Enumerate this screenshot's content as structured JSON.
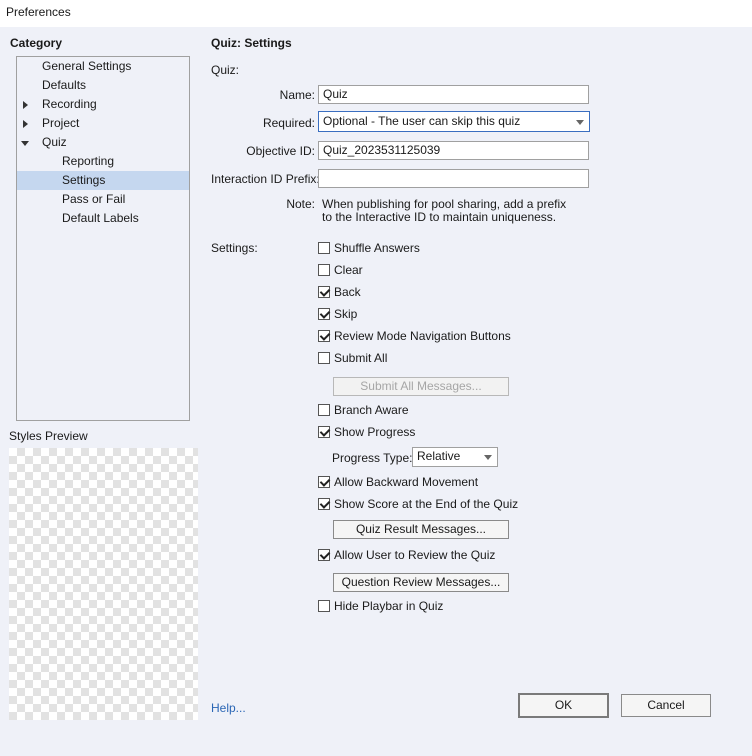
{
  "window": {
    "title": "Preferences"
  },
  "category": {
    "heading": "Category",
    "items": [
      {
        "label": "General Settings"
      },
      {
        "label": "Defaults"
      },
      {
        "label": "Recording"
      },
      {
        "label": "Project"
      },
      {
        "label": "Quiz"
      },
      {
        "label": "Reporting"
      },
      {
        "label": "Settings"
      },
      {
        "label": "Pass or Fail"
      },
      {
        "label": "Default Labels"
      }
    ],
    "selected": "Settings"
  },
  "styles_preview": {
    "label": "Styles Preview"
  },
  "panel": {
    "title": "Quiz: Settings",
    "quiz_section": "Quiz:",
    "name": {
      "label": "Name:",
      "value": "Quiz"
    },
    "required": {
      "label": "Required:",
      "value": "Optional - The user can skip this quiz"
    },
    "objective_id": {
      "label": "Objective ID:",
      "value": "Quiz_2023531125039"
    },
    "interaction_prefix": {
      "label": "Interaction ID Prefix:",
      "value": ""
    },
    "note": {
      "label": "Note:",
      "line1": "When publishing for pool sharing, add a prefix",
      "line2": "to the Interactive ID to maintain uniqueness."
    },
    "settings_label": "Settings:",
    "checkboxes": [
      {
        "label": "Shuffle Answers",
        "checked": false
      },
      {
        "label": "Clear",
        "checked": false
      },
      {
        "label": "Back",
        "checked": true
      },
      {
        "label": "Skip",
        "checked": true
      },
      {
        "label": "Review Mode Navigation Buttons",
        "checked": true
      },
      {
        "label": "Submit All",
        "checked": false
      },
      {
        "label": "Branch Aware",
        "checked": false
      },
      {
        "label": "Show Progress",
        "checked": true
      },
      {
        "label": "Allow Backward Movement",
        "checked": true
      },
      {
        "label": "Show Score at the End of the Quiz",
        "checked": true
      },
      {
        "label": "Allow User to Review the Quiz",
        "checked": true
      },
      {
        "label": "Hide Playbar in Quiz",
        "checked": false
      }
    ],
    "submit_all_messages": "Submit All Messages...",
    "progress_type": {
      "label": "Progress Type:",
      "value": "Relative"
    },
    "quiz_result_messages": "Quiz Result Messages...",
    "question_review_messages": "Question Review Messages..."
  },
  "footer": {
    "help": "Help...",
    "ok": "OK",
    "cancel": "Cancel"
  },
  "colors": {
    "panel_bg": "#eff1f8",
    "selection": "#c5d7ef",
    "link": "#2a66b5",
    "focus_border": "#3a6ec0"
  }
}
